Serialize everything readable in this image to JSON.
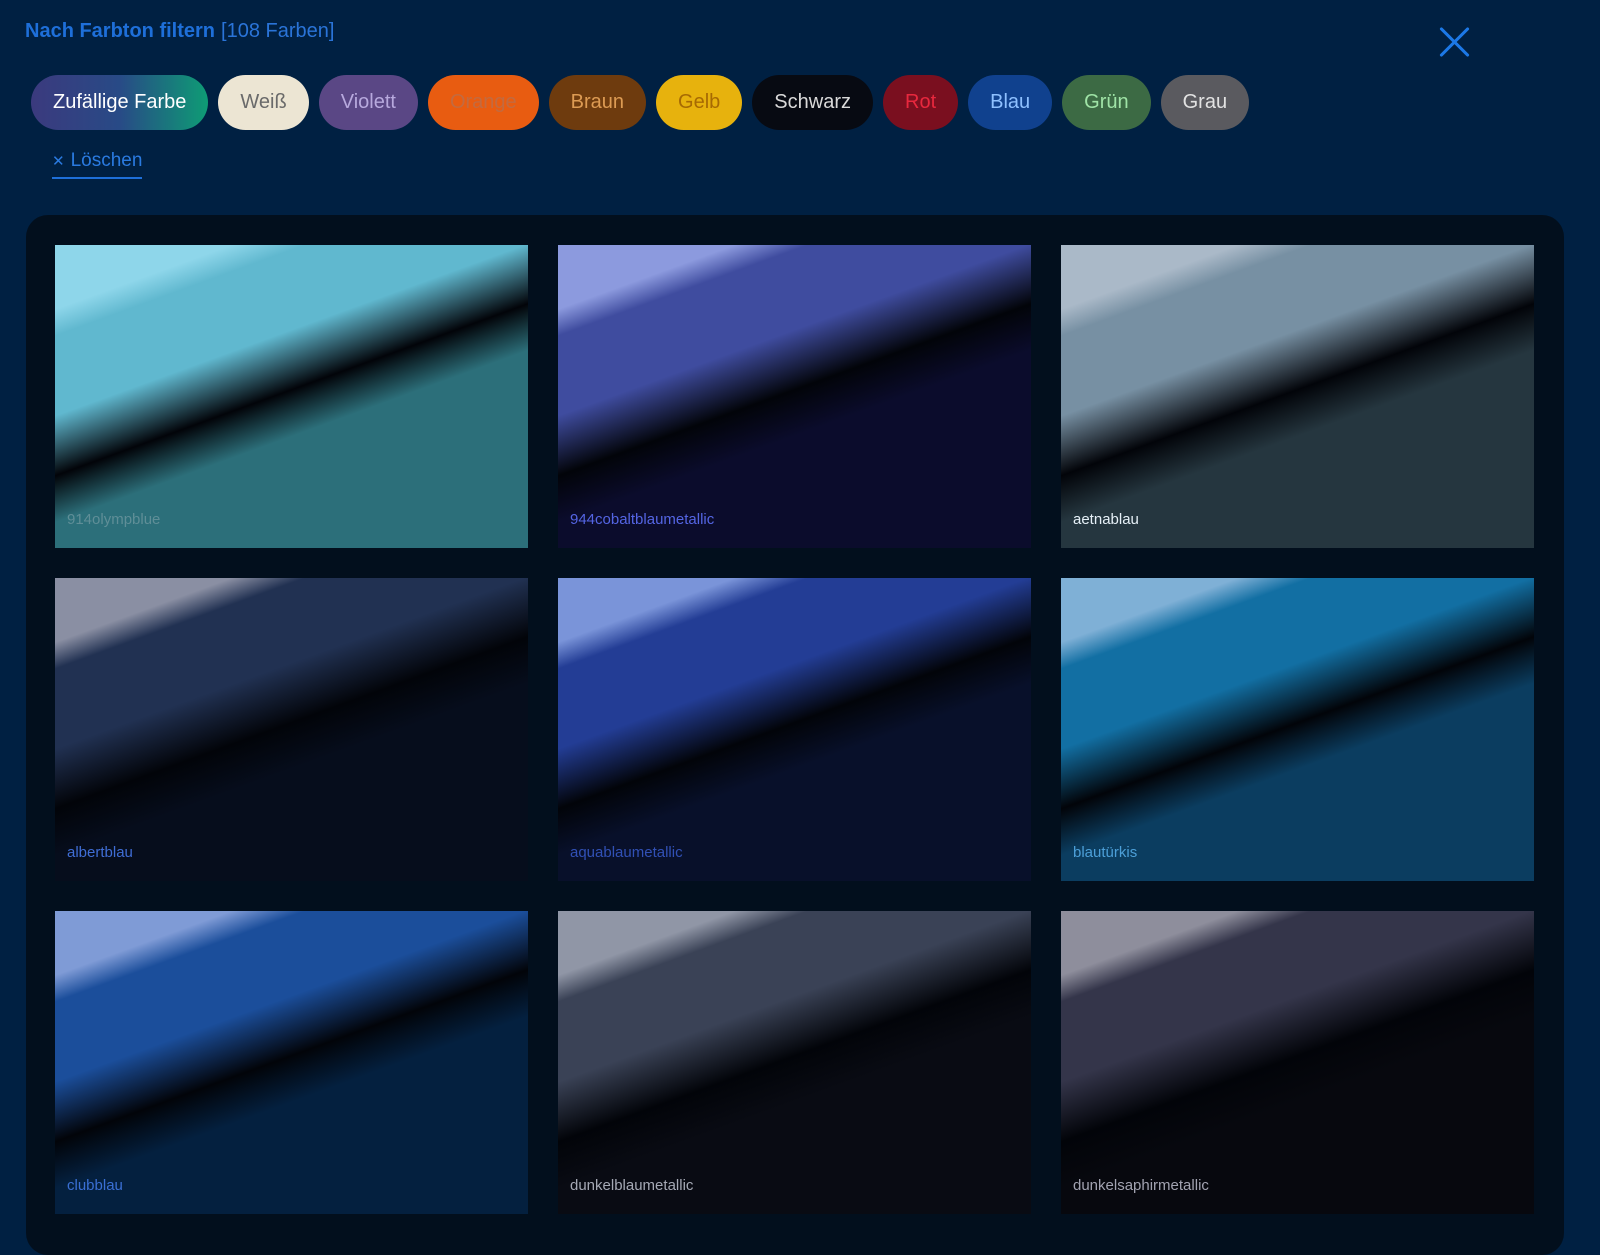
{
  "header": {
    "title": "Nach Farbton filtern",
    "count": "[108 Farben]"
  },
  "filters": [
    {
      "label": "Zufällige Farbe",
      "bg": "linear-gradient(90deg,#3b3a7e 0%,#284a86 50%,#0e9c75 100%)",
      "fg": "#ffffff"
    },
    {
      "label": "Weiß",
      "bg": "#ece5d3",
      "fg": "#6a6a6a"
    },
    {
      "label": "Violett",
      "bg": "#5a4785",
      "fg": "#b7a9dd"
    },
    {
      "label": "Orange",
      "bg": "#e85c11",
      "fg": "#c36a3f"
    },
    {
      "label": "Braun",
      "bg": "#6e3b0e",
      "fg": "#dd9b53"
    },
    {
      "label": "Gelb",
      "bg": "#e7b20d",
      "fg": "#a66a03"
    },
    {
      "label": "Schwarz",
      "bg": "#070a12",
      "fg": "#d9d9d9"
    },
    {
      "label": "Rot",
      "bg": "#7a0f1f",
      "fg": "#e8283e"
    },
    {
      "label": "Blau",
      "bg": "#10418e",
      "fg": "#8ec0ff"
    },
    {
      "label": "Grün",
      "bg": "#3c6a44",
      "fg": "#9fe3a6"
    },
    {
      "label": "Grau",
      "bg": "#5a5a5f",
      "fg": "#e2e2e2"
    }
  ],
  "clear_label": "Löschen",
  "colors": [
    {
      "name": "914olympblue",
      "light": "#8ed6ea",
      "mid": "#60b8cf",
      "dark": "#2c6f7a",
      "labelColor": "#5f8e97"
    },
    {
      "name": "944cobaltblaumetallic",
      "light": "#8c9ade",
      "mid": "#3f4c9f",
      "dark": "#0b0c2c",
      "labelColor": "#5465e3"
    },
    {
      "name": "aetnablau",
      "light": "#aab9c8",
      "mid": "#7790a3",
      "dark": "#25363f",
      "labelColor": "#e6f0f7"
    },
    {
      "name": "albertblau",
      "light": "#8a8fa3",
      "mid": "#213152",
      "dark": "#060d1c",
      "labelColor": "#3f6dd4"
    },
    {
      "name": "aquablaumetallic",
      "light": "#7a94d9",
      "mid": "#233d95",
      "dark": "#08102a",
      "labelColor": "#3150b5"
    },
    {
      "name": "blautürkis",
      "light": "#7fb0d6",
      "mid": "#126fa3",
      "dark": "#0b3d60",
      "labelColor": "#4c9fd8"
    },
    {
      "name": "clubblau",
      "light": "#7f9bd6",
      "mid": "#1b4e9b",
      "dark": "#04203f",
      "labelColor": "#3a6fd4"
    },
    {
      "name": "dunkelblaumetallic",
      "light": "#9096a6",
      "mid": "#3a4256",
      "dark": "#090b13",
      "labelColor": "#a5a9b5"
    },
    {
      "name": "dunkelsaphirmetallic",
      "light": "#8e8e9c",
      "mid": "#34354a",
      "dark": "#07080e",
      "labelColor": "#a2a3b1"
    }
  ]
}
